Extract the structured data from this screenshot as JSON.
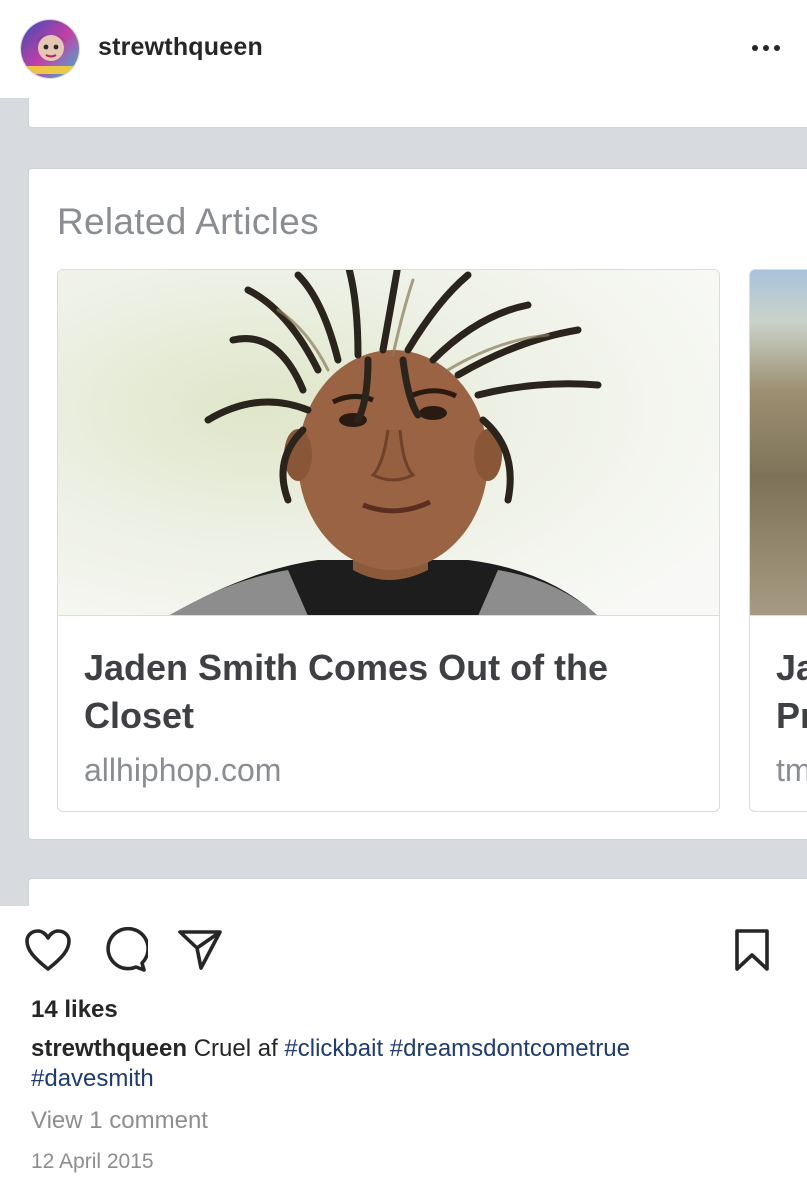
{
  "post": {
    "username": "strewthqueen",
    "more_icon": "more-horizontal-icon",
    "avatar_icon": "profile-avatar"
  },
  "screenshot": {
    "section_title": "Related Articles",
    "articles": [
      {
        "title": "Jaden Smith Comes Out of the Closet",
        "source": "allhiphop.com"
      },
      {
        "title": "Ja\nPr",
        "source": "tm"
      }
    ]
  },
  "actions": {
    "like_icon": "heart-icon",
    "comment_icon": "comment-icon",
    "share_icon": "send-icon",
    "save_icon": "bookmark-icon"
  },
  "likes": "14 likes",
  "caption": {
    "username": "strewthqueen",
    "text": " Cruel af ",
    "tags": [
      "#clickbait",
      "#dreamsdontcometrue",
      "#davesmith"
    ]
  },
  "view_comments": "View 1 comment",
  "date": "12 April 2015"
}
